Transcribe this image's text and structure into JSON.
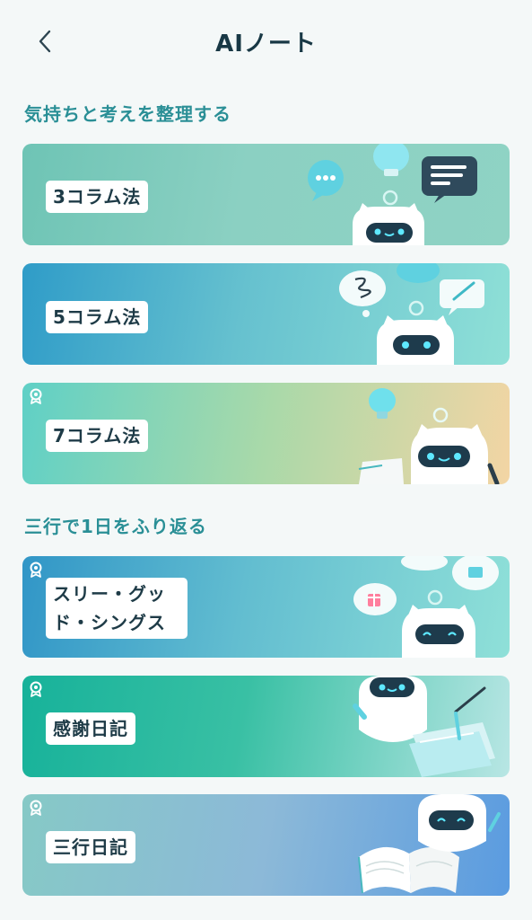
{
  "header": {
    "title": "AIノート",
    "back_icon": "chevron-left-icon"
  },
  "sections": [
    {
      "title": "気持ちと考えを整理する",
      "cards": [
        {
          "label": "3コラム法",
          "locked": false,
          "gradient": [
            "#6ec4b5",
            "#8fd3c4"
          ]
        },
        {
          "label": "5コラム法",
          "locked": false,
          "gradient": [
            "#2f9cc8",
            "#8fe0d7"
          ]
        },
        {
          "label": "7コラム法",
          "locked": true,
          "gradient": [
            "#5fd0c6",
            "#f3d5a4"
          ]
        }
      ]
    },
    {
      "title": "三行で1日をふり返る",
      "cards": [
        {
          "label_line1": "スリー・グッ",
          "label_line2": "ド・シングス",
          "locked": true,
          "gradient": [
            "#3196c7",
            "#8fe0d8"
          ]
        },
        {
          "label": "感謝日記",
          "locked": true,
          "gradient": [
            "#17b29a",
            "#b8e6e4"
          ]
        },
        {
          "label": "三行日記",
          "locked": true,
          "gradient": [
            "#86c9c6",
            "#5a9be0"
          ]
        }
      ]
    }
  ],
  "colors": {
    "background": "#f4f8f8",
    "section_title": "#2a8f96",
    "label_text": "#1e3b47"
  }
}
